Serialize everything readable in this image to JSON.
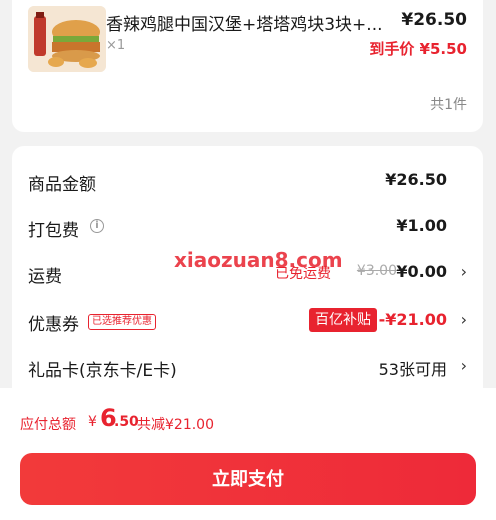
{
  "product": {
    "title": "香辣鸡腿中国汉堡+塔塔鸡块3块+...",
    "quantity": "×1",
    "price": "¥26.50",
    "final_price": "到手价 ¥5.50",
    "count": "共1件"
  },
  "summary": {
    "goods_amount_label": "商品金额",
    "goods_amount_value": "¥26.50",
    "packing_label": "打包费",
    "packing_value": "¥1.00",
    "shipping_label": "运费",
    "shipping_free_tag": "已免运费",
    "shipping_original": "¥3.00",
    "shipping_value": "¥0.00",
    "coupon_label": "优惠券",
    "coupon_recommend_tag": "已选推荐优惠",
    "coupon_subsidy_tag": "百亿补贴",
    "coupon_value": "-¥21.00",
    "giftcard_label": "礼品卡(京东卡/E卡)",
    "giftcard_value": "53张可用"
  },
  "watermark": "xiaozuan8.com",
  "footer": {
    "total_label": "应付总额",
    "total_currency": "¥",
    "total_integer": "6",
    "total_decimal": ".50",
    "total_saving": "共减¥21.00",
    "pay_button": "立即支付"
  },
  "colors": {
    "accent": "#e8232f",
    "background": "#f2f2f2"
  }
}
